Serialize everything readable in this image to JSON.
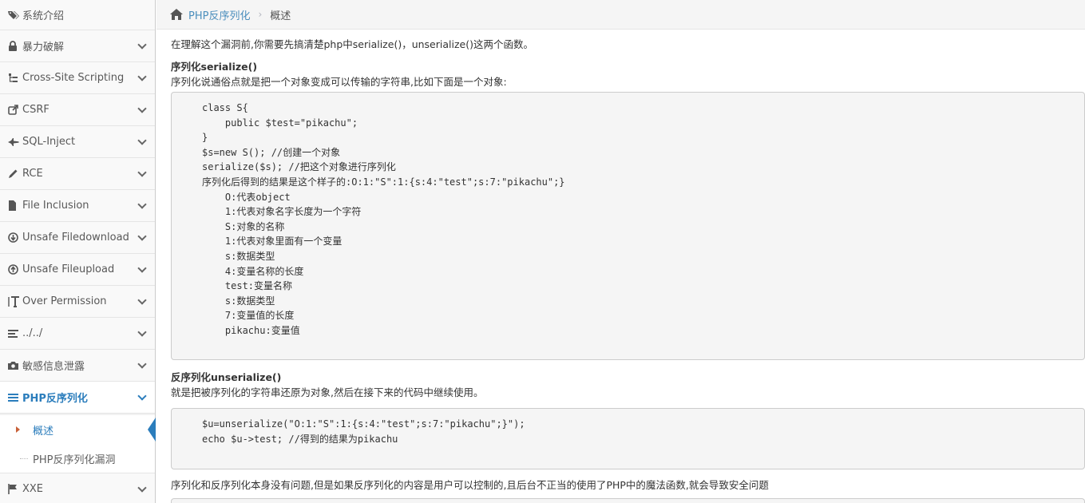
{
  "sidebar": {
    "items": [
      {
        "label": "系统介绍",
        "icon": "tags-icon"
      },
      {
        "label": "暴力破解",
        "icon": "lock-icon"
      },
      {
        "label": "Cross-Site Scripting",
        "icon": "sitemap-icon"
      },
      {
        "label": "CSRF",
        "icon": "external-link-icon"
      },
      {
        "label": "SQL-Inject",
        "icon": "fighter-jet-icon"
      },
      {
        "label": "RCE",
        "icon": "pencil-icon"
      },
      {
        "label": "File Inclusion",
        "icon": "file-icon"
      },
      {
        "label": "Unsafe Filedownload",
        "icon": "download-circle-icon"
      },
      {
        "label": "Unsafe Fileupload",
        "icon": "upload-circle-icon"
      },
      {
        "label": "Over Permission",
        "icon": "text-height-icon"
      },
      {
        "label": "../../",
        "icon": "align-left-icon"
      },
      {
        "label": "敏感信息泄露",
        "icon": "camera-icon"
      },
      {
        "label": "PHP反序列化",
        "icon": "list-icon"
      }
    ],
    "sub_items": [
      {
        "label": "概述"
      },
      {
        "label": "PHP反序列化漏洞"
      }
    ],
    "after": {
      "label": "XXE",
      "icon": "flag-icon"
    }
  },
  "breadcrumb": {
    "link": "PHP反序列化",
    "separator": "›",
    "current": "概述"
  },
  "content": {
    "intro": "在理解这个漏洞前,你需要先搞清楚php中serialize()，unserialize()这两个函数。",
    "h1": "序列化serialize()",
    "p1": "序列化说通俗点就是把一个对象变成可以传输的字符串,比如下面是一个对象:",
    "code1": "class S{\n    public $test=\"pikachu\";\n}\n$s=new S(); //创建一个对象\nserialize($s); //把这个对象进行序列化\n序列化后得到的结果是这个样子的:O:1:\"S\":1:{s:4:\"test\";s:7:\"pikachu\";}\n    O:代表object\n    1:代表对象名字长度为一个字符\n    S:对象的名称\n    1:代表对象里面有一个变量\n    s:数据类型\n    4:变量名称的长度\n    test:变量名称\n    s:数据类型\n    7:变量值的长度\n    pikachu:变量值",
    "h2": "反序列化unserialize()",
    "p2": "就是把被序列化的字符串还原为对象,然后在接下来的代码中继续使用。",
    "code2": "$u=unserialize(\"O:1:\"S\":1:{s:4:\"test\";s:7:\"pikachu\";}\");\necho $u->test; //得到的结果为pikachu",
    "p3": "序列化和反序列化本身没有问题,但是如果反序列化的内容是用户可以控制的,且后台不正当的使用了PHP中的魔法函数,就会导致安全问题"
  }
}
